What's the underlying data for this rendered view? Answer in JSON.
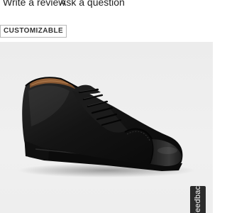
{
  "header": {
    "write_review_label": "Write a review",
    "ask_question_label": "Ask a question"
  },
  "badge": {
    "label": "CUSTOMIZABLE"
  },
  "product_image": {
    "alt": "Black leather cap-toe oxford dress shoe"
  },
  "feedback": {
    "label": "Feedback"
  },
  "colors": {
    "stage_background": "#eeeeee",
    "shoe_black": "#141414",
    "interior_tan": "#8a5a33",
    "feedback_tab": "#2b2b2b"
  }
}
